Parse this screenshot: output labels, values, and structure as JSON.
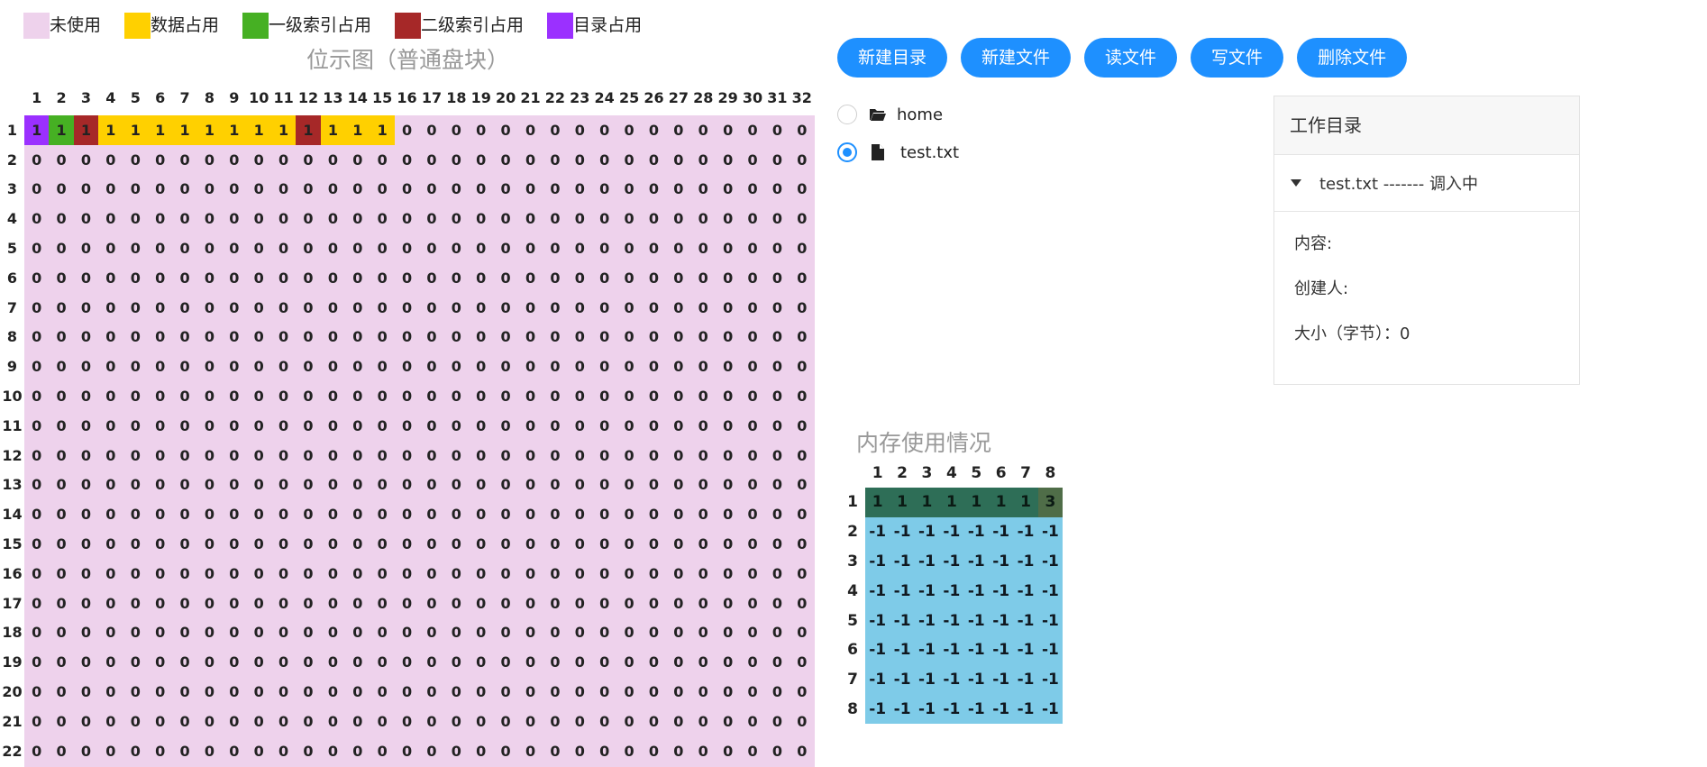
{
  "legend": [
    {
      "label": "未使用",
      "color": "#eed2ec"
    },
    {
      "label": "数据占用",
      "color": "#ffd000"
    },
    {
      "label": "一级索引占用",
      "color": "#46b023"
    },
    {
      "label": "二级索引占用",
      "color": "#a62828"
    },
    {
      "label": "目录占用",
      "color": "#9b30ff"
    }
  ],
  "bitmap": {
    "title": "位示图（普通盘块）",
    "columns": 32,
    "visible_rows": 23,
    "row1_values": [
      1,
      1,
      1,
      1,
      1,
      1,
      1,
      1,
      1,
      1,
      1,
      1,
      1,
      1,
      1,
      0,
      0,
      0,
      0,
      0,
      0,
      0,
      0,
      0,
      0,
      0,
      0,
      0,
      0,
      0,
      0,
      0
    ],
    "row1_types": [
      "dir",
      "l1",
      "l2",
      "data",
      "data",
      "data",
      "data",
      "data",
      "data",
      "data",
      "data",
      "l2",
      "data",
      "data",
      "data"
    ],
    "other_value": 0
  },
  "toolbar": {
    "new_dir": "新建目录",
    "new_file": "新建文件",
    "read_file": "读文件",
    "write_file": "写文件",
    "delete_file": "删除文件"
  },
  "file_tree": {
    "items": [
      {
        "label": "home",
        "icon": "folder-open-icon",
        "selected": false
      },
      {
        "label": "test.txt",
        "icon": "file-icon",
        "selected": true
      }
    ]
  },
  "work_panel": {
    "title": "工作目录",
    "current_file": "test.txt ------- 调入中",
    "content_label": "内容:",
    "creator_label": "创建人:",
    "size_label": "大小（字节）：0"
  },
  "memory": {
    "title": "内存使用情况",
    "columns": 8,
    "rows": 8,
    "row1_values": [
      1,
      1,
      1,
      1,
      1,
      1,
      1,
      3
    ],
    "free_value": -1
  }
}
